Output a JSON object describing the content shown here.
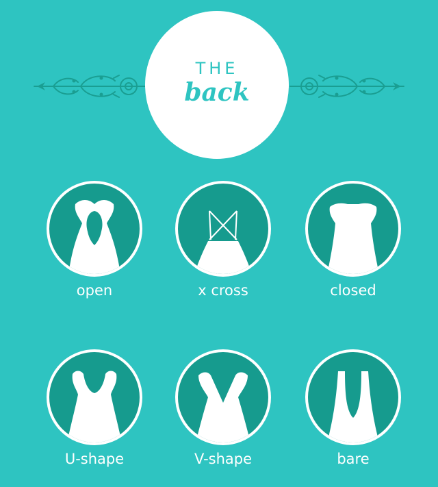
{
  "title": {
    "line1": "THE",
    "line2": "back"
  },
  "styles": [
    {
      "label": "open",
      "icon": "open-back-dress-icon"
    },
    {
      "label": "x cross",
      "icon": "x-cross-back-dress-icon"
    },
    {
      "label": "closed",
      "icon": "closed-back-dress-icon"
    },
    {
      "label": "U-shape",
      "icon": "u-shape-back-dress-icon"
    },
    {
      "label": "V-shape",
      "icon": "v-shape-back-dress-icon"
    },
    {
      "label": "bare",
      "icon": "bare-back-dress-icon"
    }
  ],
  "colors": {
    "background": "#2ec4c1",
    "badge": "#169b8e",
    "ornament": "#1a9e92",
    "text": "#ffffff"
  }
}
